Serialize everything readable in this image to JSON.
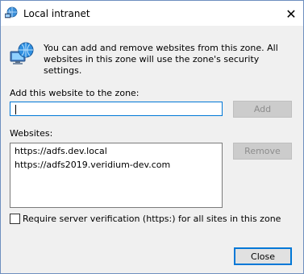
{
  "window": {
    "title": "Local intranet"
  },
  "info": {
    "text": "You can add and remove websites from this zone. All websites in this zone will use the zone's security settings."
  },
  "add": {
    "label": "Add this website to the zone:",
    "value": "",
    "button_label": "Add",
    "button_enabled": false
  },
  "websites": {
    "label": "Websites:",
    "items": [
      "https://adfs.dev.local",
      "https://adfs2019.veridium-dev.com"
    ],
    "remove_label": "Remove",
    "remove_enabled": false
  },
  "verification": {
    "label": "Require server verification (https:) for all sites in this zone",
    "checked": false
  },
  "footer": {
    "close_label": "Close"
  },
  "icons": {
    "title": "globe-network-icon",
    "info": "network-computer-globe-icon",
    "close": "close-icon"
  },
  "colors": {
    "accent": "#0078d7",
    "disabled_text": "#8d8d8d"
  }
}
